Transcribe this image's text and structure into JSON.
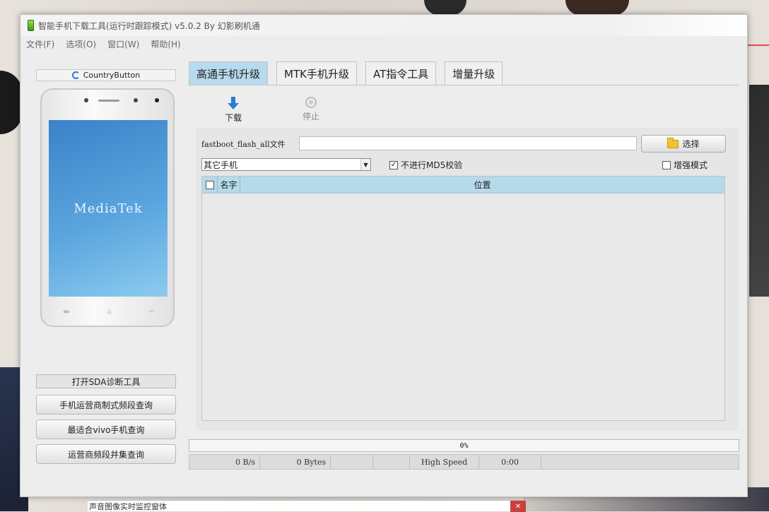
{
  "window": {
    "title": "智能手机下载工具(运行时跟踪模式)  v5.0.2 By 幻影刷机通"
  },
  "menu": [
    "文件(F)",
    "选项(O)",
    "窗口(W)",
    "帮助(H)"
  ],
  "left": {
    "country_button": "CountryButton",
    "phone_screen_text": "MediaTek",
    "buttons": [
      "打开SDA诊断工具",
      "手机运营商制式频段查询",
      "最适合vivo手机查询",
      "运营商频段并集查询"
    ]
  },
  "tabs": [
    "高通手机升级",
    "MTK手机升级",
    "AT指令工具",
    "增量升级"
  ],
  "toolbar": {
    "download": "下载",
    "stop": "停止"
  },
  "form": {
    "file_label": "fastboot_flash_all文件",
    "file_value": "",
    "choose": "选择",
    "phone_select": "其它手机",
    "md5_label": "不进行MD5校验",
    "md5_checked": true,
    "enhanced_label": "增强模式",
    "enhanced_checked": false
  },
  "table": {
    "columns": [
      "名字",
      "位置"
    ]
  },
  "progress": {
    "text": "0%",
    "value": 0
  },
  "status": {
    "cells": [
      "0 B/s",
      "0 Bytes",
      "",
      "",
      "High Speed",
      "0:00",
      ""
    ]
  },
  "taskbar": {
    "title": "声音图像实时监控窗体"
  }
}
